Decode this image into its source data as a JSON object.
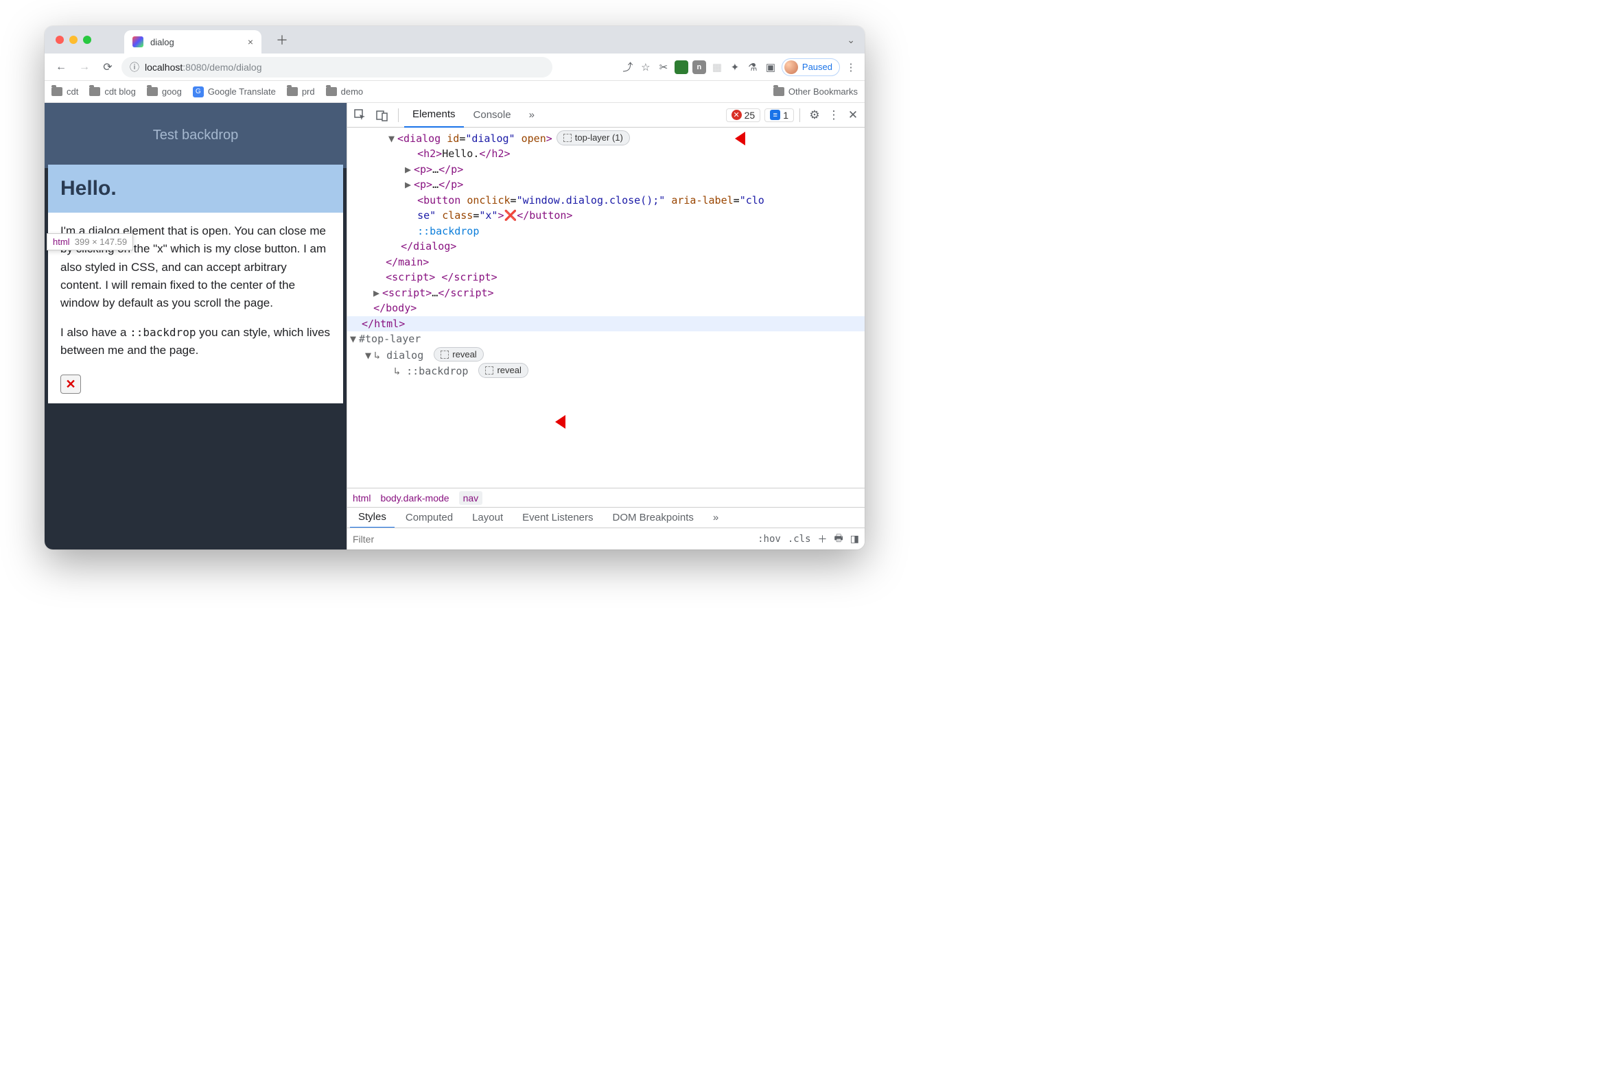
{
  "chrome": {
    "tab_title": "dialog",
    "url_display": {
      "host": "localhost",
      "port": ":8080",
      "path": "/demo/dialog"
    },
    "paused_label": "Paused",
    "bookmarks": [
      "cdt",
      "cdt blog",
      "goog",
      "Google Translate",
      "prd",
      "demo"
    ],
    "other_bookmarks": "Other Bookmarks"
  },
  "page": {
    "header": "Test backdrop",
    "h2": "Hello.",
    "tooltip_tag": "html",
    "tooltip_dim": "399 × 147.59",
    "p1": "I'm a dialog element that is open. You can close me by clicking on the \"x\" which is my close button. I am also styled in CSS, and can accept arbitrary content. I will remain fixed to the center of the window by default as you scroll the page.",
    "p2_a": "I also have a ",
    "p2_code": "::backdrop",
    "p2_b": " you can style, which lives between me and the page.",
    "x": "✕"
  },
  "devtools": {
    "tabs": {
      "elements": "Elements",
      "console": "Console",
      "more": "»"
    },
    "errors": "25",
    "info": "1",
    "top_layer_badge": "top-layer (1)",
    "reveal": "reveal",
    "code": {
      "dialog_open": "<dialog id=\"dialog\" open>",
      "h2": "<h2>Hello.</h2>",
      "p": "<p>…</p>",
      "button_a": "<button onclick=\"window.dialog.close();\" aria-label=\"clo",
      "button_b": "se\" class=\"x\">❌</button>",
      "backdrop": "::backdrop",
      "dialog_close": "</dialog>",
      "main_close": "</main>",
      "script1": "<script> </script>",
      "script2": "<script>…</script>",
      "body_close": "</body>",
      "html_close": "</html>",
      "toplayer": "#top-layer",
      "toplayer_dialog": "dialog",
      "toplayer_backdrop": "::backdrop"
    },
    "crumbs": [
      "html",
      "body.dark-mode",
      "nav"
    ],
    "styles_tabs": [
      "Styles",
      "Computed",
      "Layout",
      "Event Listeners",
      "DOM Breakpoints",
      "»"
    ],
    "filter_placeholder": "Filter",
    "hov": ":hov",
    "cls": ".cls"
  }
}
